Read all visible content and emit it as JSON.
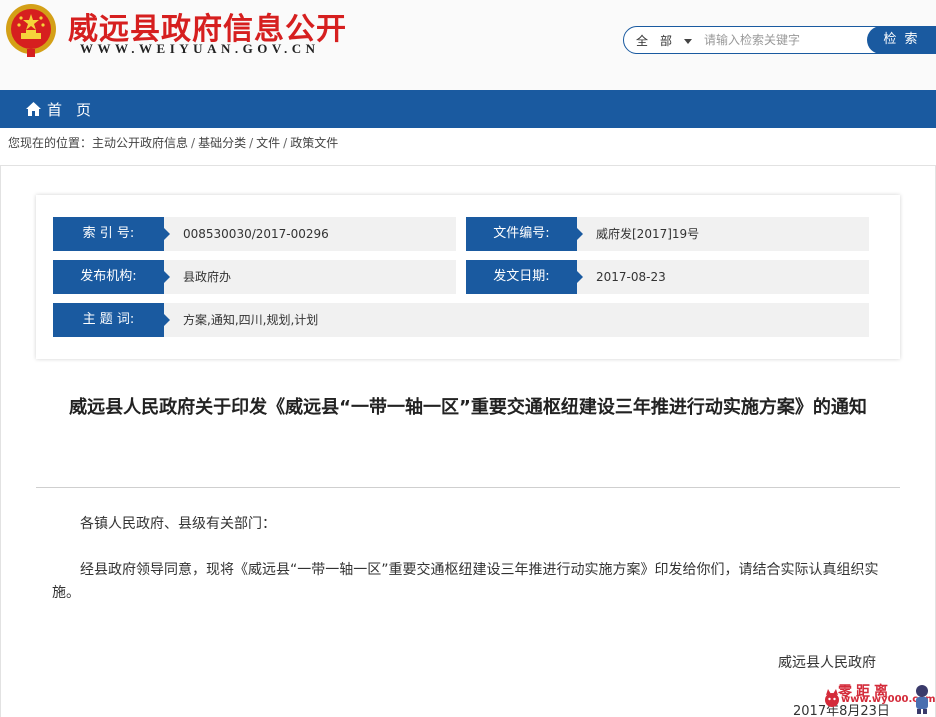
{
  "header": {
    "site_title": "威远县政府信息公开",
    "site_url": "WWW.WEIYUAN.GOV.CN"
  },
  "search": {
    "scope": "全　部",
    "placeholder": "请输入检索关键字",
    "button_label": "检 索"
  },
  "nav": {
    "home_label": "首页"
  },
  "breadcrumb": {
    "prefix": "您现在的位置：",
    "items": [
      "主动公开政府信息",
      "基础分类",
      "文件",
      "政策文件"
    ]
  },
  "info": {
    "index_label": "索 引 号:",
    "index_value": "008530030/2017-00296",
    "docno_label": "文件编号:",
    "docno_value": "威府发[2017]19号",
    "publisher_label": "发布机构:",
    "publisher_value": "县政府办",
    "date_label": "发文日期:",
    "date_value": "2017-08-23",
    "subject_label": "主 题 词:",
    "subject_value": "方案,通知,四川,规划,计划"
  },
  "document": {
    "title": "威远县人民政府关于印发《威远县“一带一轴一区”重要交通枢纽建设三年推进行动实施方案》的通知",
    "salutation": "各镇人民政府、县级有关部门：",
    "body": "经县政府领导同意，现将《威远县“一带一轴一区”重要交通枢纽建设三年推进行动实施方案》印发给你们，请结合实际认真组织实施。",
    "signature": "威远县人民政府",
    "date": "2017年8月23日"
  },
  "watermark": {
    "text": "零距离",
    "url": "www.wy000.com"
  },
  "colors": {
    "brand_blue": "#1a5aa0",
    "title_red": "#d61f1f",
    "watermark_red": "#d42b3a"
  }
}
